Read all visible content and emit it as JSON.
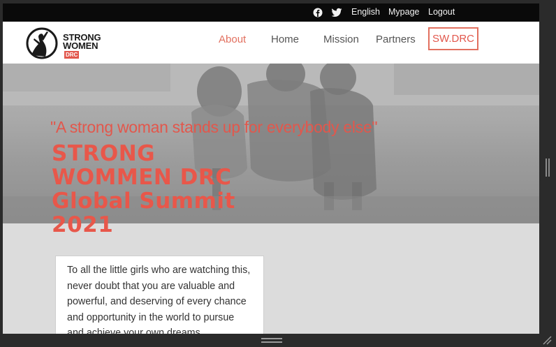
{
  "topbar": {
    "icons": [
      "facebook-icon",
      "twitter-icon"
    ],
    "links": [
      "English",
      "Mypage",
      "Logout"
    ]
  },
  "logo": {
    "line1": "STRONG",
    "line2": "WOMEN",
    "badge": "DRC"
  },
  "nav": {
    "items": [
      "About",
      "Home",
      "Mission",
      "Partners"
    ],
    "active": "About",
    "button": "SW.DRC"
  },
  "hero": {
    "quote": "\"A strong woman stands up for everybody else\"",
    "title_lines": [
      "STRONG",
      "WOMMEN DRC",
      "Global Summit",
      "2021"
    ]
  },
  "card": {
    "text": "To all the little girls who are watching this, never doubt that you are valuable and powerful, and deserving of every chance and opportunity in the world to pursue and achieve your own dreams."
  },
  "colors": {
    "accent": "#e2574c",
    "topbar": "#0a0a0a",
    "chrome": "#2b2b2b"
  }
}
